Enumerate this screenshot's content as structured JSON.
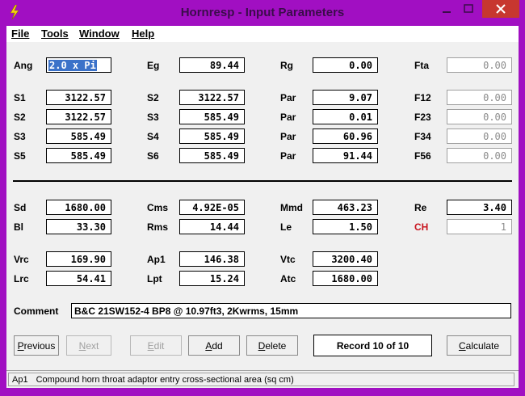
{
  "window": {
    "title": "Hornresp - Input Parameters",
    "title_color": "#3a0d4a",
    "frame_color": "#a10fc2",
    "close_color": "#c7372f"
  },
  "menu": [
    {
      "label": "File"
    },
    {
      "label": "Tools"
    },
    {
      "label": "Window"
    },
    {
      "label": "Help"
    }
  ],
  "params": {
    "ang": {
      "label": "Ang",
      "value": "2.0 x Pi"
    },
    "eg": {
      "label": "Eg",
      "value": "89.44"
    },
    "rg": {
      "label": "Rg",
      "value": "0.00"
    },
    "fta": {
      "label": "Fta",
      "value": "0.00"
    },
    "s1": {
      "label": "S1",
      "value": "3122.57"
    },
    "s2a": {
      "label": "S2",
      "value": "3122.57"
    },
    "s2b": {
      "label": "S2",
      "value": "3122.57"
    },
    "s3a": {
      "label": "S3",
      "value": "585.49"
    },
    "s3b": {
      "label": "S3",
      "value": "585.49"
    },
    "s4": {
      "label": "S4",
      "value": "585.49"
    },
    "s5": {
      "label": "S5",
      "value": "585.49"
    },
    "s6": {
      "label": "S6",
      "value": "585.49"
    },
    "par1": {
      "label": "Par",
      "value": "9.07"
    },
    "par2": {
      "label": "Par",
      "value": "0.01"
    },
    "par3": {
      "label": "Par",
      "value": "60.96"
    },
    "par4": {
      "label": "Par",
      "value": "91.44"
    },
    "f12": {
      "label": "F12",
      "value": "0.00"
    },
    "f23": {
      "label": "F23",
      "value": "0.00"
    },
    "f34": {
      "label": "F34",
      "value": "0.00"
    },
    "f56": {
      "label": "F56",
      "value": "0.00"
    },
    "sd": {
      "label": "Sd",
      "value": "1680.00"
    },
    "bl": {
      "label": "Bl",
      "value": "33.30"
    },
    "cms": {
      "label": "Cms",
      "value": "4.92E-05"
    },
    "rms": {
      "label": "Rms",
      "value": "14.44"
    },
    "mmd": {
      "label": "Mmd",
      "value": "463.23"
    },
    "le": {
      "label": "Le",
      "value": "1.50"
    },
    "re": {
      "label": "Re",
      "value": "3.40"
    },
    "ch": {
      "label": "CH",
      "value": "1"
    },
    "vrc": {
      "label": "Vrc",
      "value": "169.90"
    },
    "lrc": {
      "label": "Lrc",
      "value": "54.41"
    },
    "ap1": {
      "label": "Ap1",
      "value": "146.38"
    },
    "lpt": {
      "label": "Lpt",
      "value": "15.24"
    },
    "vtc": {
      "label": "Vtc",
      "value": "3200.40"
    },
    "atc": {
      "label": "Atc",
      "value": "1680.00"
    }
  },
  "comment": {
    "label": "Comment",
    "value": "B&C 21SW152-4 BP8 @ 10.97ft3, 2Kwrms, 15mm"
  },
  "buttons": {
    "previous": {
      "label": "Previous",
      "accel": "P",
      "rest": "revious"
    },
    "next": {
      "label": "Next",
      "accel": "N",
      "rest": "ext"
    },
    "edit": {
      "label": "Edit",
      "accel": "E",
      "rest": "dit"
    },
    "add": {
      "label": "Add",
      "accel": "A",
      "rest": "dd"
    },
    "delete": {
      "label": "Delete",
      "accel": "D",
      "rest": "elete"
    },
    "calculate": {
      "label": "Calculate",
      "accel": "C",
      "rest": "alculate"
    }
  },
  "record": "Record 10 of 10",
  "status": {
    "param": "Ap1",
    "description": "Compound horn throat adaptor entry cross-sectional area  (sq cm)"
  }
}
